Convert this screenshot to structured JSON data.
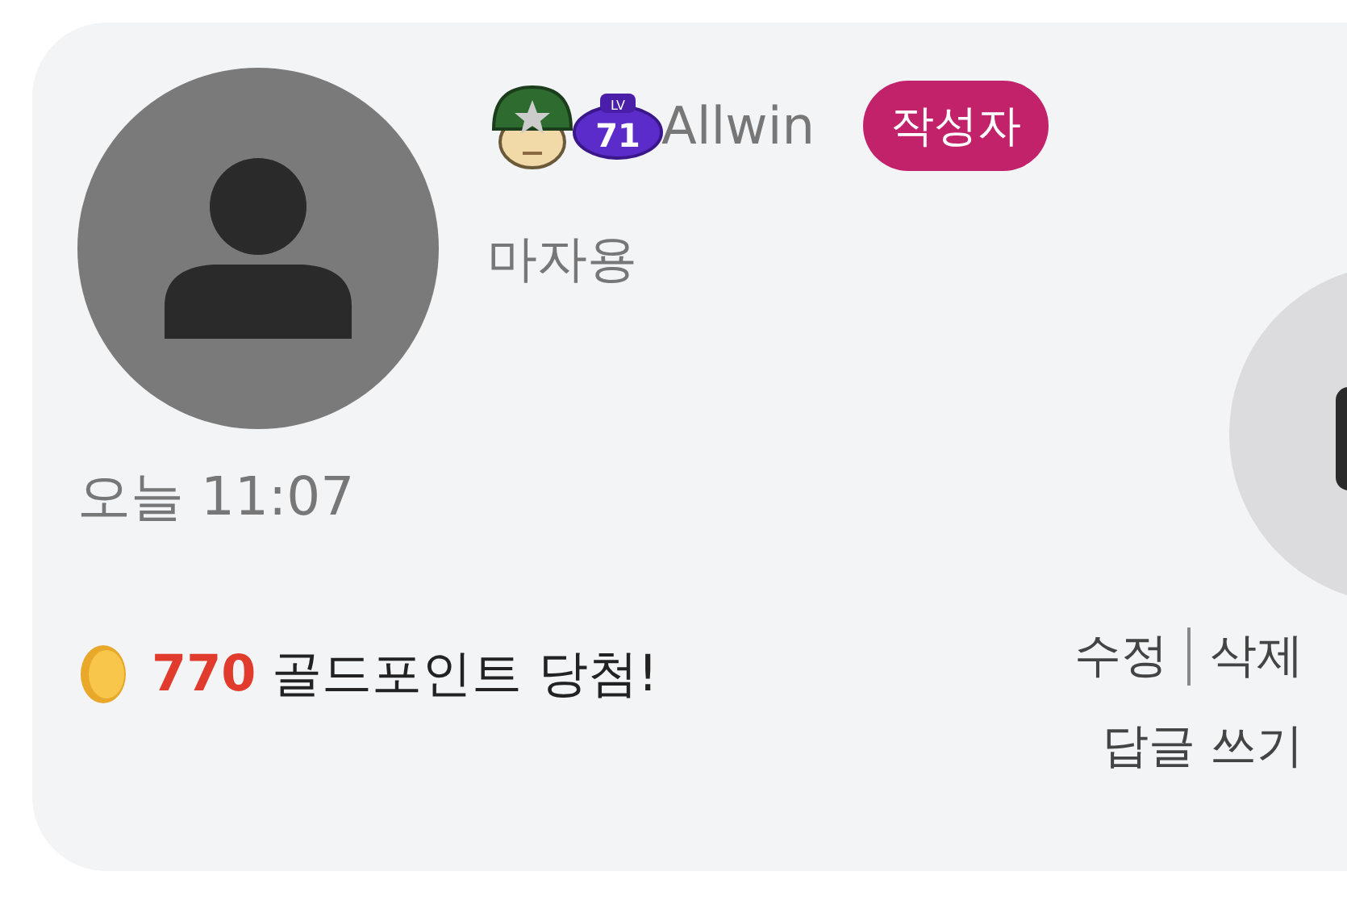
{
  "comment": {
    "author": "Allwin",
    "level_label": "LV",
    "level_badge": "71",
    "author_tag": "작성자",
    "nickname": "마자용",
    "time": "오늘 11:07",
    "reward": {
      "amount": "770",
      "text": "골드포인트 당첨!"
    },
    "actions": [
      "수정",
      "삭제"
    ],
    "reply": "답글 쓰기"
  }
}
